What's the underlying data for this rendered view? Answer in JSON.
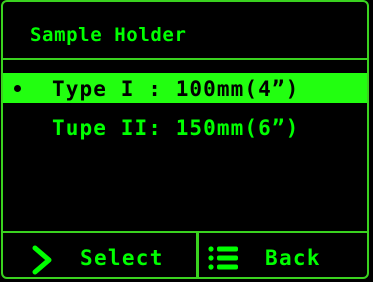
{
  "colors": {
    "background": "#000000",
    "accent": "#00ff00",
    "frame": "#3ad21f",
    "highlight": "#22ff10",
    "highlight_text": "#000000"
  },
  "header": {
    "title": "Sample Holder"
  },
  "menu": {
    "items": [
      {
        "label": "Type I : 100mm(4”)",
        "selected": true
      },
      {
        "label": "Tupe II: 150mm(6”)",
        "selected": false
      }
    ]
  },
  "footer": {
    "select_label": "Select",
    "select_icon": "chevron-right-icon",
    "back_label": "Back",
    "back_icon": "list-icon"
  }
}
